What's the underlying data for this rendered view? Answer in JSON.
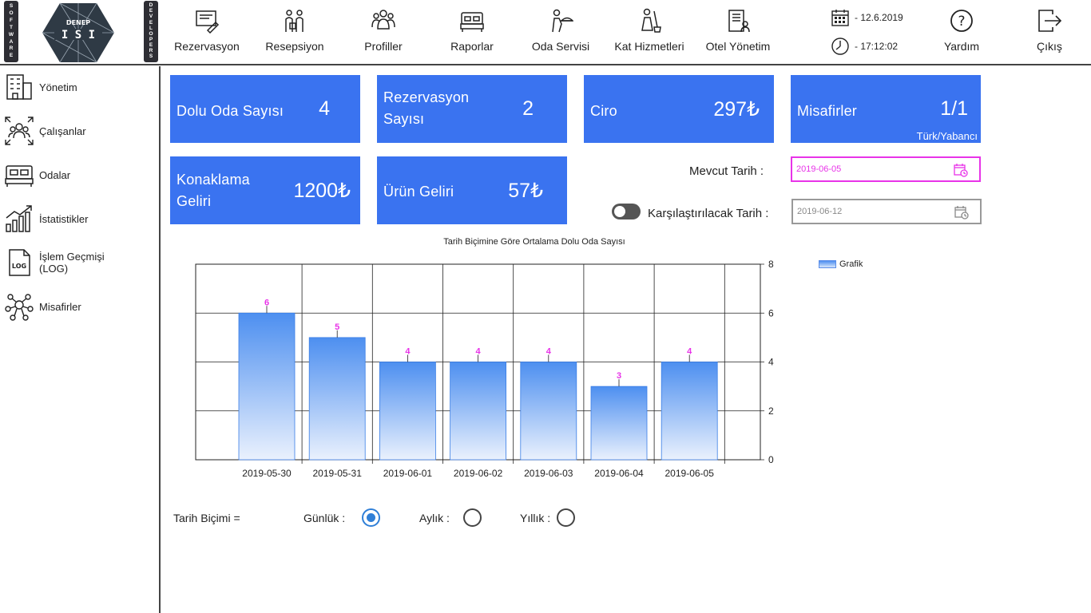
{
  "brand": {
    "strip_left": [
      "S",
      "O",
      "F",
      "T",
      "W",
      "A",
      "R",
      "E"
    ],
    "strip_right": [
      "D",
      "E",
      "V",
      "E",
      "L",
      "O",
      "P",
      "E",
      "R",
      "S"
    ],
    "logo_top": "DENEP",
    "logo_main": "I S I"
  },
  "nav": [
    {
      "label": "Rezervasyon",
      "icon": "reservation-icon"
    },
    {
      "label": "Resepsiyon",
      "icon": "reception-icon"
    },
    {
      "label": "Profiller",
      "icon": "profiles-icon"
    },
    {
      "label": "Raporlar",
      "icon": "bed-report-icon"
    },
    {
      "label": "Oda Servisi",
      "icon": "room-service-icon"
    },
    {
      "label": "Kat Hizmetleri",
      "icon": "housekeeping-icon"
    },
    {
      "label": "Otel Yönetim",
      "icon": "hotel-management-icon"
    }
  ],
  "datetime": {
    "date": "- 12.6.2019",
    "time": "- 17:12:02"
  },
  "help": {
    "label": "Yardım"
  },
  "exit": {
    "label": "Çıkış"
  },
  "sidebar": [
    {
      "label": "Yönetim",
      "icon": "building-icon"
    },
    {
      "label": "Çalışanlar",
      "icon": "employees-icon"
    },
    {
      "label": "Odalar",
      "icon": "bed-icon"
    },
    {
      "label": "İstatistikler",
      "icon": "statistics-icon"
    },
    {
      "label": "İşlem Geçmişi (LOG)",
      "icon": "log-file-icon"
    },
    {
      "label": "Misafirler",
      "icon": "guests-network-icon"
    }
  ],
  "cards": {
    "occupied": {
      "label": "Dolu Oda Sayısı",
      "value": "4"
    },
    "reservations": {
      "label": "Rezervasyon Sayısı",
      "value": "2"
    },
    "revenue": {
      "label": "Ciro",
      "value": "297₺"
    },
    "guests": {
      "label": "Misafirler",
      "value": "1/1",
      "sub": "Türk/Yabancı"
    },
    "accommodation": {
      "label": "Konaklama Geliri",
      "value": "1200₺"
    },
    "product": {
      "label": "Ürün Geliri",
      "value": "57₺"
    }
  },
  "dates": {
    "current_label": "Mevcut Tarih :",
    "current_value": "2019-06-05",
    "compare_label": "Karşılaştırılacak Tarih :",
    "compare_value": "2019-06-12",
    "compare_enabled": false
  },
  "colors": {
    "card": "#3a73f0",
    "value_label": "#e833e8",
    "bar_top": "#4d8ff0",
    "bar_bottom": "#eaf1fd",
    "radio": "#2f7fd7"
  },
  "chart_data": {
    "type": "bar",
    "title": "Tarih Biçimine Göre Ortalama Dolu Oda Sayısı",
    "categories": [
      "2019-05-30",
      "2019-05-31",
      "2019-06-01",
      "2019-06-02",
      "2019-06-03",
      "2019-06-04",
      "2019-06-05"
    ],
    "series": [
      {
        "name": "Grafik",
        "values": [
          6,
          5,
          4,
          4,
          4,
          3,
          4
        ]
      }
    ],
    "ylim": [
      0,
      8
    ],
    "yticks": [
      0,
      2,
      4,
      6,
      8
    ],
    "y_axis_side": "right",
    "grid": true,
    "legend": "top-right",
    "data_labels": true
  },
  "period": {
    "label": "Tarih Biçimi =",
    "options": [
      {
        "label": "Günlük :",
        "selected": true
      },
      {
        "label": "Aylık :",
        "selected": false
      },
      {
        "label": "Yıllık :",
        "selected": false
      }
    ]
  }
}
